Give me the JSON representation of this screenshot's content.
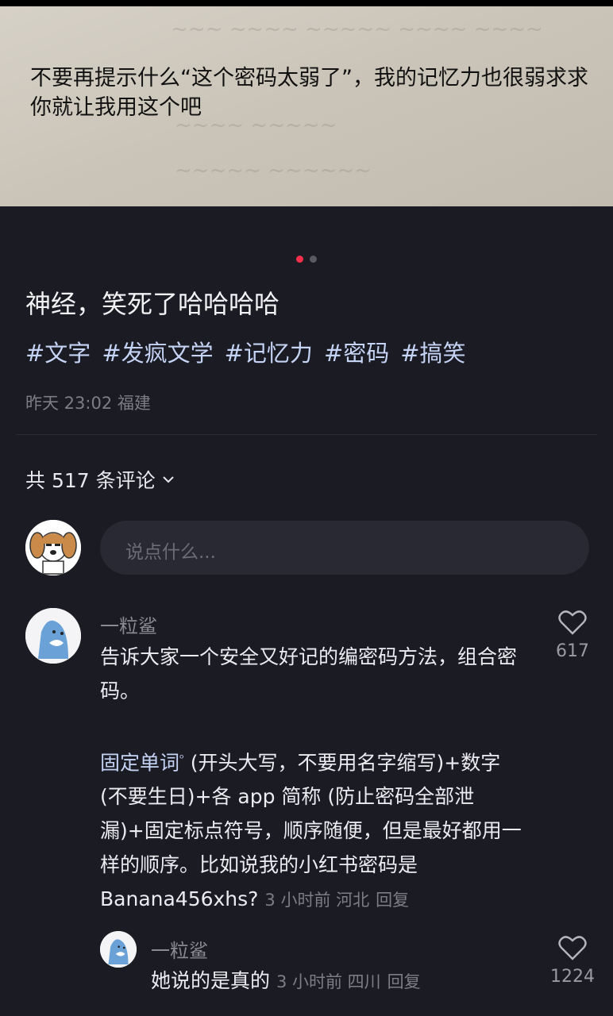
{
  "photo": {
    "text": "不要再提示什么“这个密码太弱了”，我的记忆力也很弱求求你就让我用这个吧"
  },
  "carousel": {
    "pages": 2,
    "active": 0
  },
  "post": {
    "title": "神经，笑死了哈哈哈哈",
    "tags": [
      "#文字",
      "#发疯文学",
      "#记忆力",
      "#密码",
      "#搞笑"
    ],
    "meta": "昨天 23:02 福建"
  },
  "comments_header": {
    "count_label": "共 517 条评论"
  },
  "input": {
    "placeholder": "说点什么..."
  },
  "comments": [
    {
      "author": "一粒鲨",
      "body_intro": "告诉大家一个安全又好记的编密码方法，组合密码。",
      "highlight": "固定单词",
      "body_rest": " (开头大写，不要用名字缩写)+数字 (不要生日)+各 app 简称 (防止密码全部泄漏)+固定标点符号，顺序随便，但是最好都用一样的顺序。比如说我的小红书密码是Banana456xhs?",
      "meta": "3 小时前 河北",
      "reply_label": "回复",
      "likes": "617"
    },
    {
      "author": "一粒鲨",
      "body": "她说的是真的",
      "meta": "3 小时前 四川",
      "reply_label": "回复",
      "likes": "1224"
    }
  ],
  "colors": {
    "background": "#1b1b24",
    "accent": "#ff2e4d",
    "tag": "#c5d3f5"
  }
}
